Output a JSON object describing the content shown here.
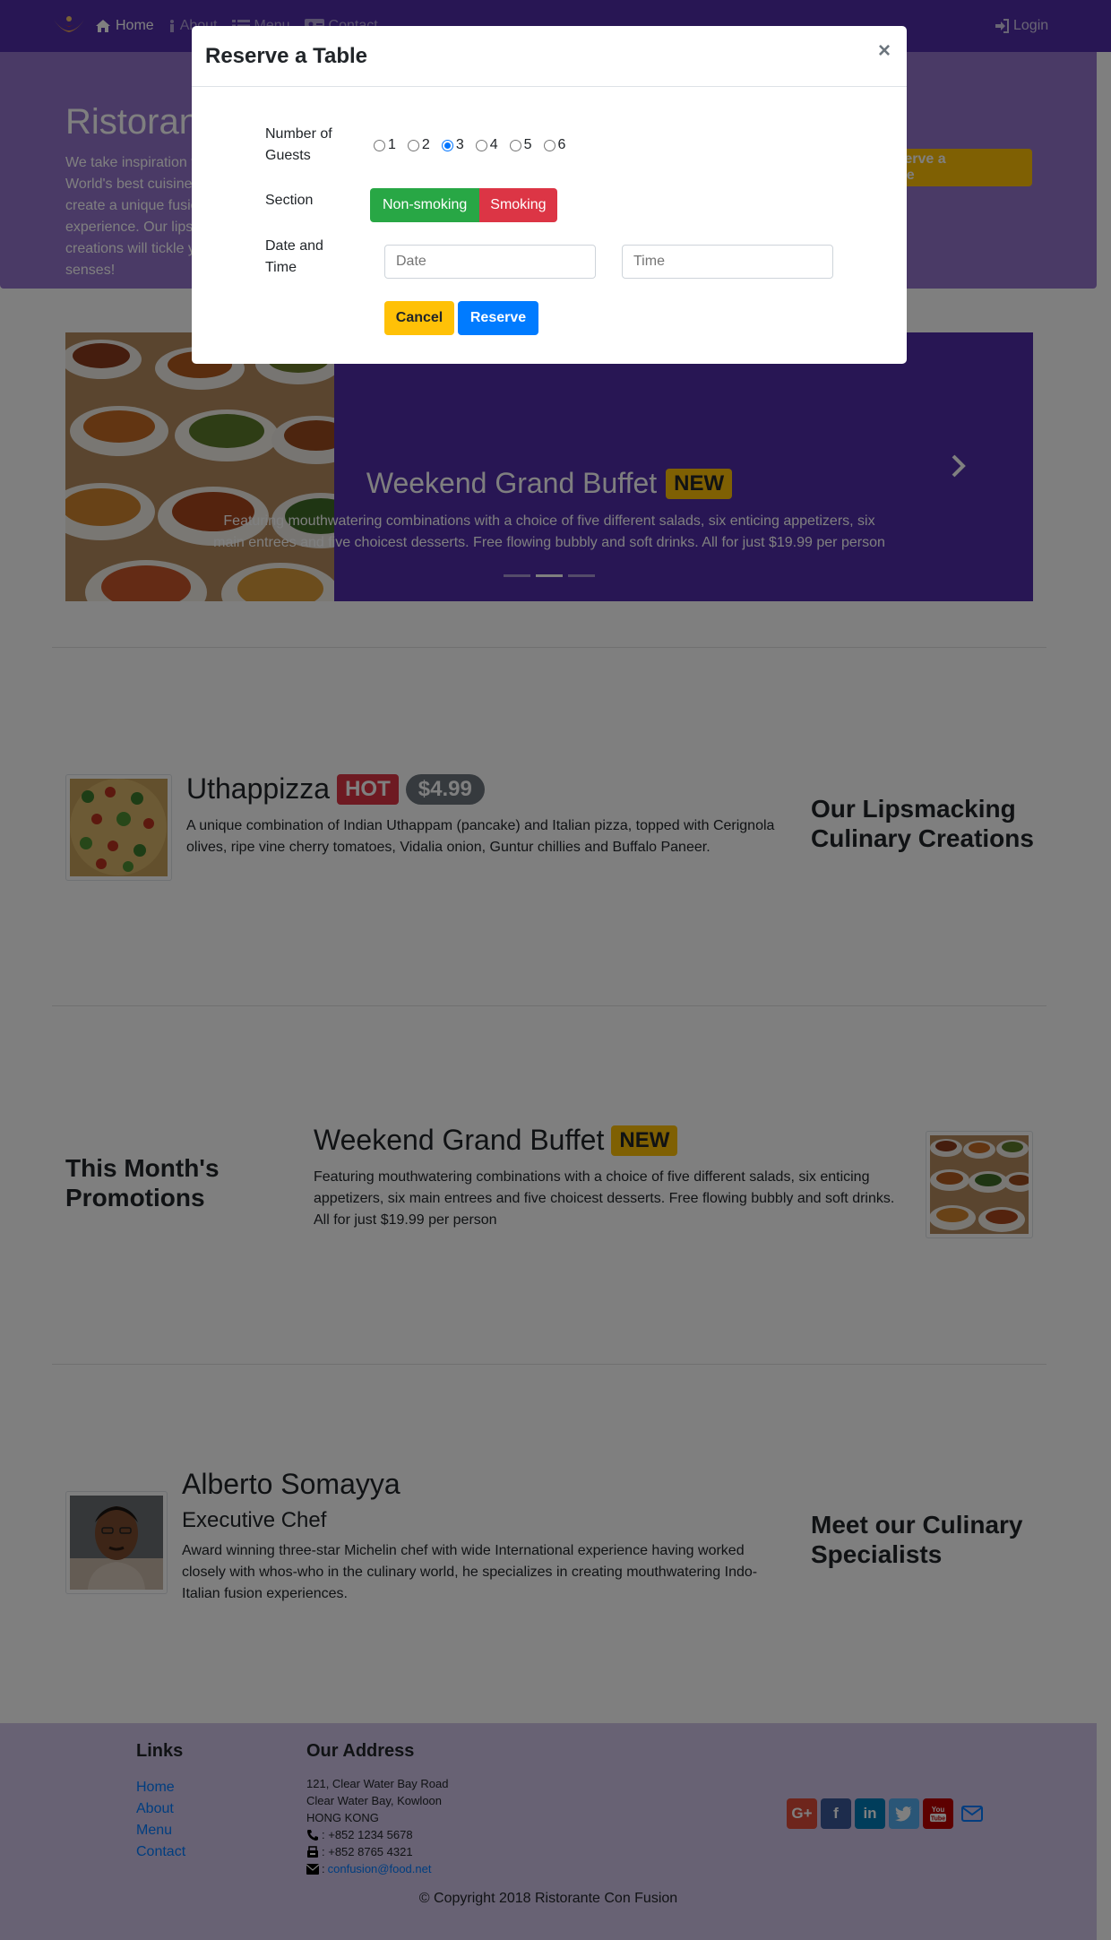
{
  "navbar": {
    "items": [
      {
        "label": "Home",
        "icon": "home-icon"
      },
      {
        "label": "About",
        "icon": "info-icon"
      },
      {
        "label": "Menu",
        "icon": "list-icon"
      },
      {
        "label": "Contact",
        "icon": "address-card-icon"
      }
    ],
    "login": "Login"
  },
  "jumbotron": {
    "title": "Ristorante Con Fusion",
    "text": "We take inspiration from the World's best cuisines, and create a unique fusion experience. Our lipsmacking creations will tickle your culinary senses!",
    "button": "Reserve a Table"
  },
  "carousel": {
    "title": "Weekend Grand Buffet",
    "badge": "NEW",
    "text": "Featuring mouthwatering combinations with a choice of five different salads, six enticing appetizers, six main entrees and five choicest desserts. Free flowing bubbly and soft drinks. All for just $19.99 per person"
  },
  "dish": {
    "title": "Uthappizza",
    "badge": "HOT",
    "price": "$4.99",
    "text": "A unique combination of Indian Uthappam (pancake) and Italian pizza, topped with Cerignola olives, ripe vine cherry tomatoes, Vidalia onion, Guntur chillies and Buffalo Paneer.",
    "side_title": "Our Lipsmacking Culinary Creations"
  },
  "promotion": {
    "side_title": "This Month's Promotions",
    "title": "Weekend Grand Buffet",
    "badge": "NEW",
    "text": "Featuring mouthwatering combinations with a choice of five different salads, six enticing appetizers, six main entrees and five choicest desserts. Free flowing bubbly and soft drinks. All for just $19.99 per person"
  },
  "leader": {
    "name": "Alberto Somayya",
    "designation": "Executive Chef",
    "text": "Award winning three-star Michelin chef with wide International experience having worked closely with whos-who in the culinary world, he specializes in creating mouthwatering Indo-Italian fusion experiences.",
    "side_title": "Meet our Culinary Specialists"
  },
  "footer": {
    "links_title": "Links",
    "links": [
      "Home",
      "About",
      "Menu",
      "Contact"
    ],
    "address_title": "Our Address",
    "address": [
      "121, Clear Water Bay Road",
      "Clear Water Bay, Kowloon",
      "HONG KONG"
    ],
    "phone": ": +852 1234 5678",
    "fax": ": +852 8765 4321",
    "email_prefix": ": ",
    "email": "confusion@food.net",
    "copyright": "© Copyright 2018 Ristorante Con Fusion"
  },
  "modal": {
    "title": "Reserve a Table",
    "close": "×",
    "guests_label": "Number of Guests",
    "guests": [
      "1",
      "2",
      "3",
      "4",
      "5",
      "6"
    ],
    "guests_selected": "3",
    "section_label": "Section",
    "section_options": [
      "Non-smoking",
      "Smoking"
    ],
    "datetime_label": "Date and Time",
    "date_placeholder": "Date",
    "time_placeholder": "Time",
    "cancel": "Cancel",
    "reserve": "Reserve"
  },
  "colors": {
    "primary": "#512da8",
    "jumbotron": "#9575cd",
    "footer": "#d1c4e9",
    "warning": "#ffc107",
    "danger": "#dc3545",
    "success": "#28a745",
    "link": "#007bff"
  }
}
